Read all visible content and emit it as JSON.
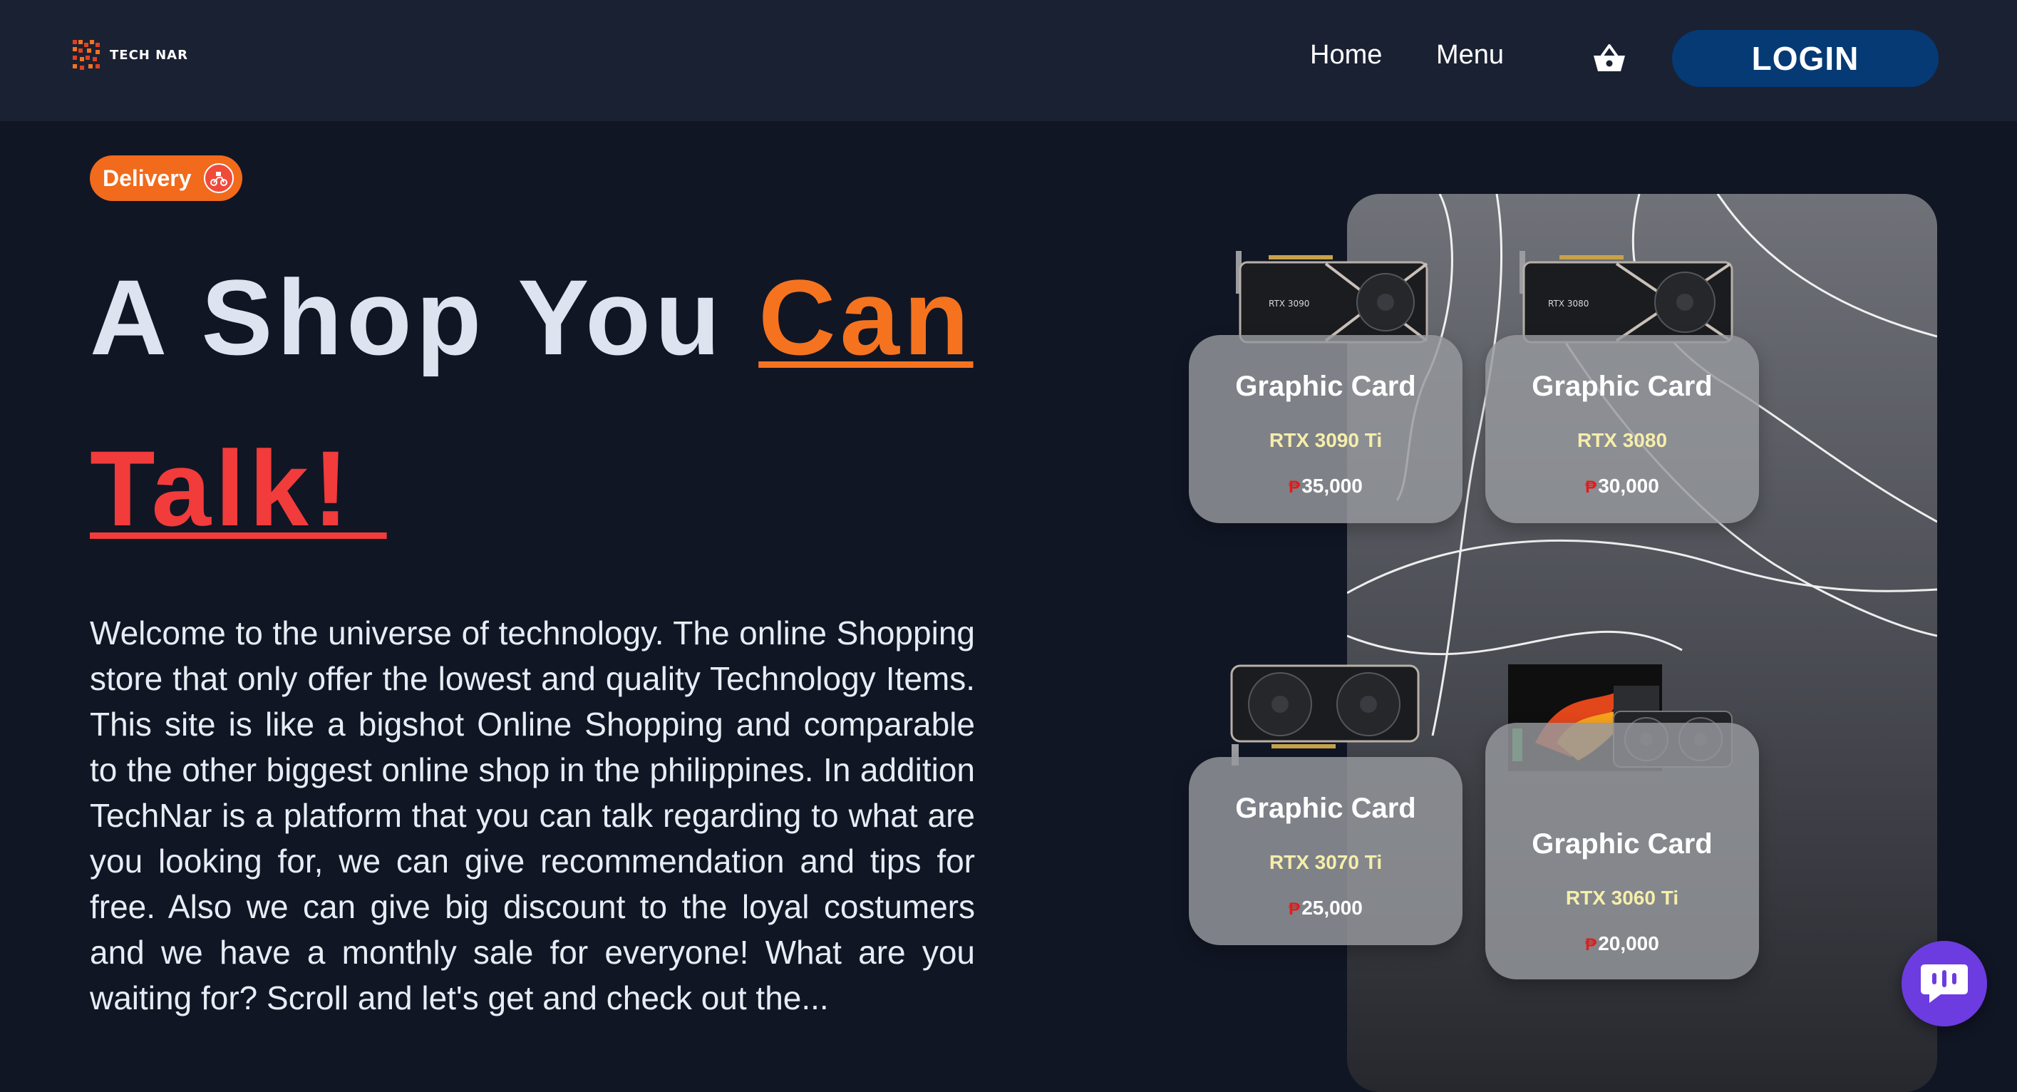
{
  "header": {
    "logo_text": "TECH NAR",
    "nav": {
      "home_label": "Home",
      "menu_label": "Menu"
    },
    "cart_icon": "shopping-basket-icon",
    "login_label": "LOGIN"
  },
  "hero": {
    "badge_label": "Delivery",
    "badge_icon": "delivery-scooter-icon",
    "title_part1": "A Shop You ",
    "title_accent": "Can",
    "title_line2": "Talk! ",
    "paragraph": "Welcome to the universe of technology. The online Shopping store that only offer the lowest and quality Technology Items. This site is like a bigshot Online Shopping and comparable to the other biggest online shop in the philippines. In addition TechNar is a platform that you can talk regarding to what are you looking for, we can give recommendation and tips for free. Also we can give big discount to the loyal costumers and we have a monthly sale for everyone! What are you waiting for? Scroll and let's get and check out the..."
  },
  "products": [
    {
      "title": "Graphic Card",
      "model": "RTX 3090 Ti",
      "price": "35,000",
      "currency": "₱",
      "image_label": "RTX 3090"
    },
    {
      "title": "Graphic Card",
      "model": "RTX 3080",
      "price": "30,000",
      "currency": "₱",
      "image_label": "RTX 3080"
    },
    {
      "title": "Graphic Card",
      "model": "RTX 3070 Ti",
      "price": "25,000",
      "currency": "₱"
    },
    {
      "title": "Graphic Card",
      "model": "RTX 3060 Ti",
      "price": "20,000",
      "currency": "₱"
    }
  ],
  "chat": {
    "icon": "chat-bubble-icon"
  },
  "colors": {
    "background": "#111625",
    "navbar": "#1a2133",
    "login_button": "#053a75",
    "accent_orange": "#f5731f",
    "accent_red": "#f23b3b",
    "badge": "#f26a1b",
    "model_text": "#f6eeaa",
    "chat_button": "#6c3ce0"
  }
}
